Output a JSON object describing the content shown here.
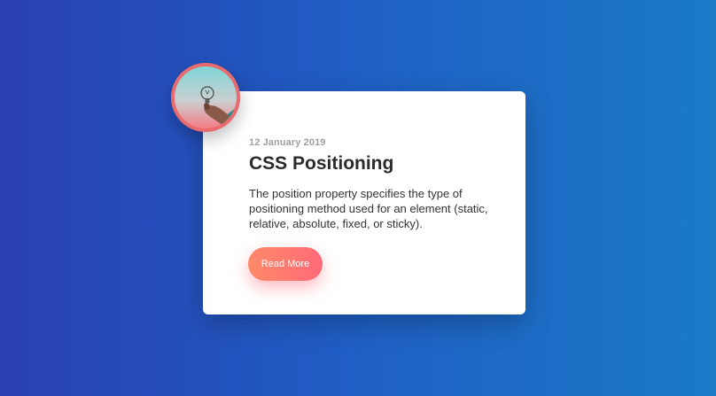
{
  "card": {
    "date": "12 January 2019",
    "title": "CSS Positioning",
    "description": "The position property specifies the type of positioning method used for an element (static, relative, absolute, fixed, or sticky).",
    "button_label": "Read More"
  },
  "colors": {
    "background_start": "#2a3fb2",
    "background_end": "#1b7ac8",
    "button_start": "#ff8a68",
    "button_end": "#ff6a78",
    "avatar_ring": "#e86b6f"
  },
  "avatar": {
    "icon": "lightbulb-hand-photo-icon"
  }
}
